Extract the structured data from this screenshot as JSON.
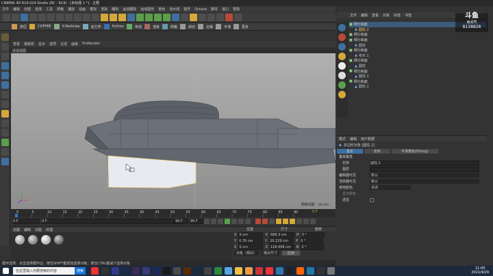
{
  "title": "CINEMA 4D R19.024 Studio (RC - R19) - [未标题 1 *] - 主要",
  "menubar": [
    "文件",
    "编辑",
    "创建",
    "选择",
    "工具",
    "网格",
    "捕捉",
    "动画",
    "模拟",
    "渲染",
    "雕刻",
    "运动跟踪",
    "运动图形",
    "角色",
    "流水线",
    "插件",
    "Octane",
    "脚本",
    "窗口",
    "帮助"
  ],
  "toolbar2_labels": [
    "挤压",
    "COFFEE",
    "Python",
    "布线",
    "斜切",
    "边缘",
    "平滑",
    "Octane",
    "ProRender",
    "Octane"
  ],
  "toolbar2_x": "X-Particles",
  "toolbar2_dyn": "动力学",
  "toolbar2_render": "渲染",
  "toolbar2_mesh": "网格",
  "toolbar2_more": "更多",
  "viewport": {
    "menu": [
      "查看",
      "摄像机",
      "显示",
      "选项",
      "过滤",
      "面板",
      "ProRender"
    ],
    "title": "透视视图",
    "grid": "网格间距 : 10 cm"
  },
  "timeline": {
    "ticks": [
      "0",
      "5",
      "10",
      "15",
      "20",
      "25",
      "30",
      "35",
      "40",
      "45",
      "50",
      "55",
      "60",
      "65",
      "70",
      "75",
      "80",
      "85",
      "90"
    ],
    "frame": "0 F"
  },
  "transport": {
    "start": "0 F",
    "current": "0 F",
    "end": "90 F",
    "endb": "90 F"
  },
  "materials": {
    "menu": [
      "创建",
      "编辑",
      "功能",
      "纹理"
    ]
  },
  "coords": {
    "headers": [
      "位置",
      "尺寸",
      "旋转"
    ],
    "rows": [
      [
        "X",
        "0 cm",
        "X",
        "688.3 cm",
        "H",
        "0 °"
      ],
      [
        "Y",
        "0.76 cm",
        "Y",
        "20.229 cm",
        "P",
        "0 °"
      ],
      [
        "Z",
        "0 cm",
        "Z",
        "118.458 cm",
        "B",
        "0 °"
      ]
    ],
    "mode": "对象（相对）",
    "size_mode": "绝对尺寸",
    "apply": "应用"
  },
  "status": "循环选择：点击选择循环边，按住SHIFT键增加选择对象；按住CTRL键减少选择对象",
  "objects": {
    "menu": [
      "文件",
      "编辑",
      "查看",
      "对象",
      "标签",
      "书签"
    ],
    "items": [
      "细分曲面",
      "圆柱.2",
      "细分曲面",
      "细分曲面",
      "圆柱",
      "细分曲面",
      "布尔.1",
      "细分曲面",
      "圆柱",
      "细分曲面",
      "圆柱.1",
      "细分曲面",
      "圆柱.1"
    ]
  },
  "watermark": {
    "brand": "房间号",
    "room": "8138828",
    "logo": "斗鱼"
  },
  "attributes": {
    "menu": [
      "模式",
      "编辑",
      "用户数据"
    ],
    "object_label": "多边形对象 [圆柱.2]",
    "tabs": [
      "基本",
      "坐标",
      "平滑着色(Phong)"
    ],
    "section": "基本属性",
    "fields": [
      {
        "label": "名称",
        "value": "圆柱.2"
      },
      {
        "label": "图层",
        "value": ""
      },
      {
        "label": "编辑器可见",
        "value": "默认"
      },
      {
        "label": "渲染器可见",
        "value": "默认"
      },
      {
        "label": "使用颜色",
        "value": "关闭"
      },
      {
        "label": "显示颜色",
        "value": ""
      },
      {
        "label": "透显",
        "value": ""
      }
    ]
  },
  "taskbar": {
    "search": "在这里输入你要搜索的内容",
    "clock": "11:00",
    "date": "2021/4/29"
  }
}
